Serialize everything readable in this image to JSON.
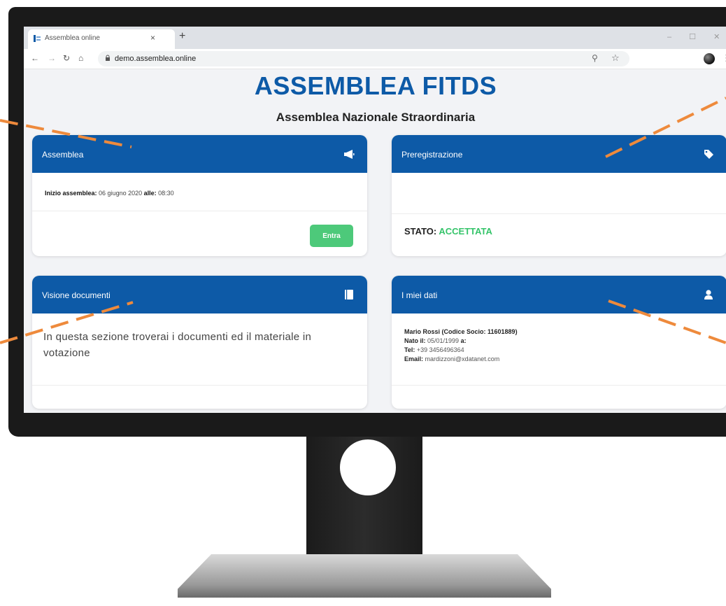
{
  "browser": {
    "tab_title": "Assemblea online",
    "tab_close": "×",
    "new_tab": "+",
    "window_controls": "– ☐ ✕",
    "url": "demo.assemblea.online",
    "icons": [
      "favicon",
      "back-icon",
      "forward-icon",
      "reload-icon",
      "home-icon",
      "lock-icon",
      "zoom-icon",
      "star-icon",
      "profile-avatar",
      "menu-icon"
    ]
  },
  "page": {
    "title": "ASSEMBLEA FITDS",
    "subtitle": "Assemblea Nazionale Straordinaria"
  },
  "cards": {
    "assemblea": {
      "title": "Assemblea",
      "icon": "megaphone-icon",
      "start_label": "Inizio assemblea:",
      "start_date": "06 giugno 2020",
      "time_label": "alle:",
      "time": "08:30",
      "button": "Entra"
    },
    "preregistrazione": {
      "title": "Preregistrazione",
      "icon": "tag-icon",
      "status_label": "STATO:",
      "status_value": "ACCETTATA"
    },
    "documenti": {
      "title": "Visione documenti",
      "icon": "book-icon",
      "text": "In questa sezione troverai i documenti ed il materiale in votazione"
    },
    "dati": {
      "title": "I miei dati",
      "icon": "user-icon",
      "name": "Mario Rossi (Codice Socio: 11601889)",
      "birth_label": "Nato il:",
      "birth_date": "05/01/1999",
      "birth_place_label": "a:",
      "tel_label": "Tel:",
      "tel": "+39 3456496364",
      "email_label": "Email:",
      "email": "mardizzoni@xdatanet.com"
    }
  },
  "colors": {
    "brand_blue": "#0d5aa7",
    "accent_green": "#4dc97a",
    "status_green": "#35c46a",
    "leader_orange": "#ee8a3c",
    "bezel": "#1a1a1a"
  }
}
